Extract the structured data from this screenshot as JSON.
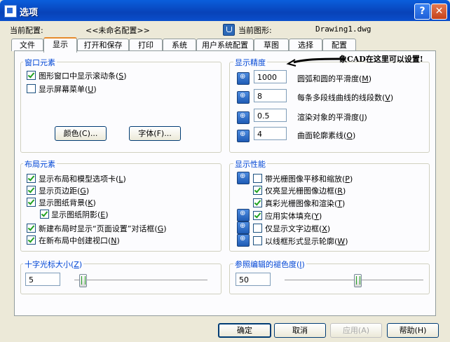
{
  "window": {
    "title": "选项",
    "help": "?",
    "close": "✕"
  },
  "header": {
    "current_config_label": "当前配置:",
    "current_config_value": "<<未命名配置>>",
    "current_drawing_label": "当前图形:",
    "current_drawing_value": "Drawing1.dwg"
  },
  "tabs": [
    "文件",
    "显示",
    "打开和保存",
    "打印",
    "系统",
    "用户系统配置",
    "草图",
    "选择",
    "配置"
  ],
  "window_elements": {
    "label": "窗口元素",
    "items": [
      {
        "text": "图形窗口中显示滚动条",
        "key": "S",
        "checked": true
      },
      {
        "text": "显示屏幕菜单",
        "key": "U",
        "checked": false
      }
    ],
    "colors_button": "颜色(C)...",
    "fonts_button": "字体(F)..."
  },
  "display_resolution": {
    "label": "显示精度",
    "annotation": "象CAD在这里可以设置!",
    "items": [
      {
        "value": "1000",
        "text": "圆弧和圆的平滑度",
        "key": "M"
      },
      {
        "value": "8",
        "text": "每条多段线曲线的线段数",
        "key": "V"
      },
      {
        "value": "0.5",
        "text": "渲染对象的平滑度",
        "key": "J"
      },
      {
        "value": "4",
        "text": "曲面轮廓素线",
        "key": "O"
      }
    ]
  },
  "layout_elements": {
    "label": "布局元素",
    "items": [
      {
        "text": "显示布局和模型选项卡",
        "key": "L",
        "checked": true
      },
      {
        "text": "显示页边距",
        "key": "G",
        "checked": true
      },
      {
        "text": "显示图纸背景",
        "key": "K",
        "checked": true
      },
      {
        "text": "显示图纸阴影",
        "key": "E",
        "checked": true
      },
      {
        "text": "新建布局时显示“页面设置”对话框",
        "key": "G",
        "checked": true
      },
      {
        "text": "在新布局中创建视口",
        "key": "N",
        "checked": true
      }
    ]
  },
  "display_performance": {
    "label": "显示性能",
    "items": [
      {
        "text": "带光栅图像平移和缩放",
        "key": "P",
        "checked": false
      },
      {
        "text": "仅亮显光栅图像边框",
        "key": "R",
        "checked": true
      },
      {
        "text": "真彩光栅图像和渲染",
        "key": "T",
        "checked": true
      },
      {
        "text": "应用实体填充",
        "key": "Y",
        "checked": true
      },
      {
        "text": "仅显示文字边框",
        "key": "X",
        "checked": false
      },
      {
        "text": "以线框形式显示轮廓",
        "key": "W",
        "checked": false
      }
    ]
  },
  "crosshair": {
    "label": "十字光标大小",
    "key": "Z",
    "value": "5",
    "slider_percent": 5
  },
  "xref_fade": {
    "label": "参照编辑的褪色度",
    "key": "I",
    "value": "50",
    "slider_percent": 50
  },
  "footer": {
    "ok": "确定",
    "cancel": "取消",
    "apply": "应用(A)",
    "help": "帮助(H)"
  }
}
